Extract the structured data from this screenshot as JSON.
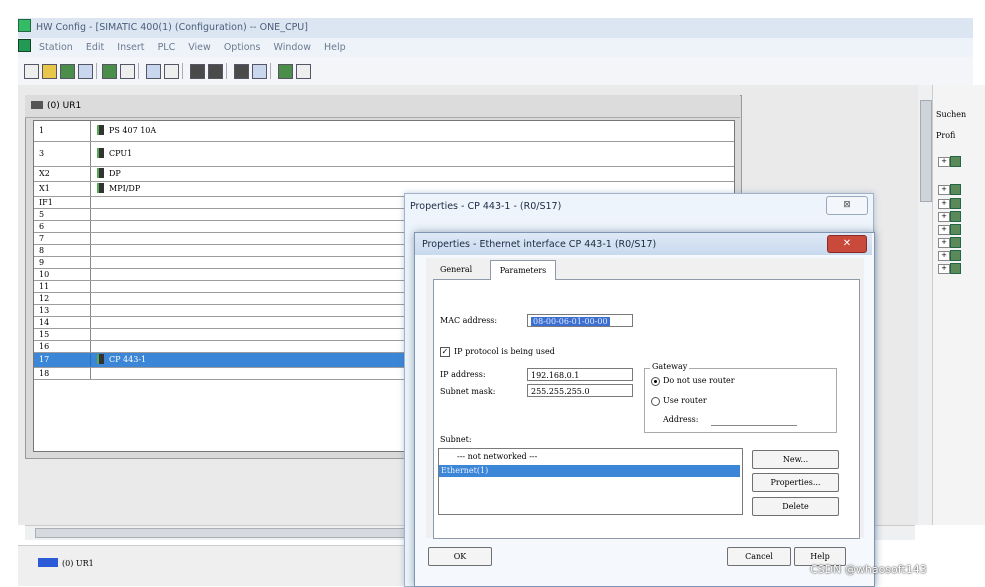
{
  "window": {
    "title": "HW Config - [SIMATIC 400(1) (Configuration) -- ONE_CPU]"
  },
  "menu": [
    "Station",
    "Edit",
    "Insert",
    "PLC",
    "View",
    "Options",
    "Window",
    "Help"
  ],
  "station": {
    "title": "(0) UR1",
    "rows": [
      {
        "slot": "1",
        "module": "PS 407 10A"
      },
      {
        "slot": "3",
        "module": "CPU1"
      },
      {
        "slot": "X2",
        "module": "DP"
      },
      {
        "slot": "X1",
        "module": "MPI/DP"
      },
      {
        "slot": "IF1",
        "module": ""
      },
      {
        "slot": "5",
        "module": ""
      },
      {
        "slot": "6",
        "module": ""
      },
      {
        "slot": "7",
        "module": ""
      },
      {
        "slot": "8",
        "module": ""
      },
      {
        "slot": "9",
        "module": ""
      },
      {
        "slot": "10",
        "module": ""
      },
      {
        "slot": "11",
        "module": ""
      },
      {
        "slot": "12",
        "module": ""
      },
      {
        "slot": "13",
        "module": ""
      },
      {
        "slot": "14",
        "module": ""
      },
      {
        "slot": "15",
        "module": ""
      },
      {
        "slot": "16",
        "module": ""
      },
      {
        "slot": "17",
        "module": "CP 443-1"
      },
      {
        "slot": "18",
        "module": ""
      }
    ]
  },
  "right_panel": {
    "search_label": "Suchen",
    "profile_label": "Profi"
  },
  "bottom": {
    "label": "(0)   UR1"
  },
  "outer_dialog": {
    "title": "Properties - CP 443-1 - (R0/S17)",
    "close": "⊠"
  },
  "inner_dialog": {
    "title": "Properties - Ethernet interface  CP 443-1 (R0/S17)",
    "close": "✕",
    "tabs": {
      "general": "General",
      "parameters": "Parameters"
    },
    "mac_label": "MAC address:",
    "mac_value": "08-00-06-01-00-00",
    "ip_protocol_label": "IP protocol is being used",
    "ip_label": "IP address:",
    "ip_value": "192.168.0.1",
    "subnet_label": "Subnet mask:",
    "subnet_value": "255.255.255.0",
    "gateway": {
      "legend": "Gateway",
      "no_router": "Do not use router",
      "use_router": "Use router",
      "address_label": "Address:"
    },
    "subnet_section_label": "Subnet:",
    "subnet_items": [
      "--- not networked ---",
      "Ethernet(1)"
    ],
    "buttons": {
      "new": "New...",
      "properties": "Properties...",
      "delete": "Delete",
      "ok": "OK",
      "cancel": "Cancel",
      "help": "Help"
    }
  },
  "watermark": "CSDN @whaosoft143"
}
